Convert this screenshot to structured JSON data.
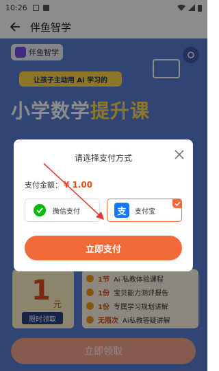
{
  "status_bar": {
    "time": "10:26"
  },
  "app_bar": {
    "title": "伴鱼智学"
  },
  "banner": {
    "logo_text": "伴鱼智学",
    "ribbon": "让孩子主动用 Ai 学习的",
    "title_main": "小学数学",
    "title_highlight": "提升课"
  },
  "offer": {
    "price": "1",
    "unit": "元",
    "limit_tag": "限时领取",
    "benefits": [
      {
        "key": "1节",
        "text": "Ai 私教体验课程"
      },
      {
        "key": "1份",
        "text": "宝贝能力测评报告"
      },
      {
        "key": "1份",
        "text": "专属学习规划讲解"
      },
      {
        "key": "无限次",
        "text": "Ai私教答疑讲解"
      }
    ],
    "claim_label": "立即领取"
  },
  "dialog": {
    "title": "请选择支付方式",
    "amount_label": "支付金额：",
    "amount_value": "¥ 1.00",
    "options": [
      {
        "label": "微信支付",
        "selected": false
      },
      {
        "label": "支付宝",
        "selected": true
      }
    ],
    "pay_button": "立即支付"
  },
  "colors": {
    "accent": "#f26a3a",
    "alipay_blue": "#1677ff",
    "wechat_green": "#09bb07"
  }
}
